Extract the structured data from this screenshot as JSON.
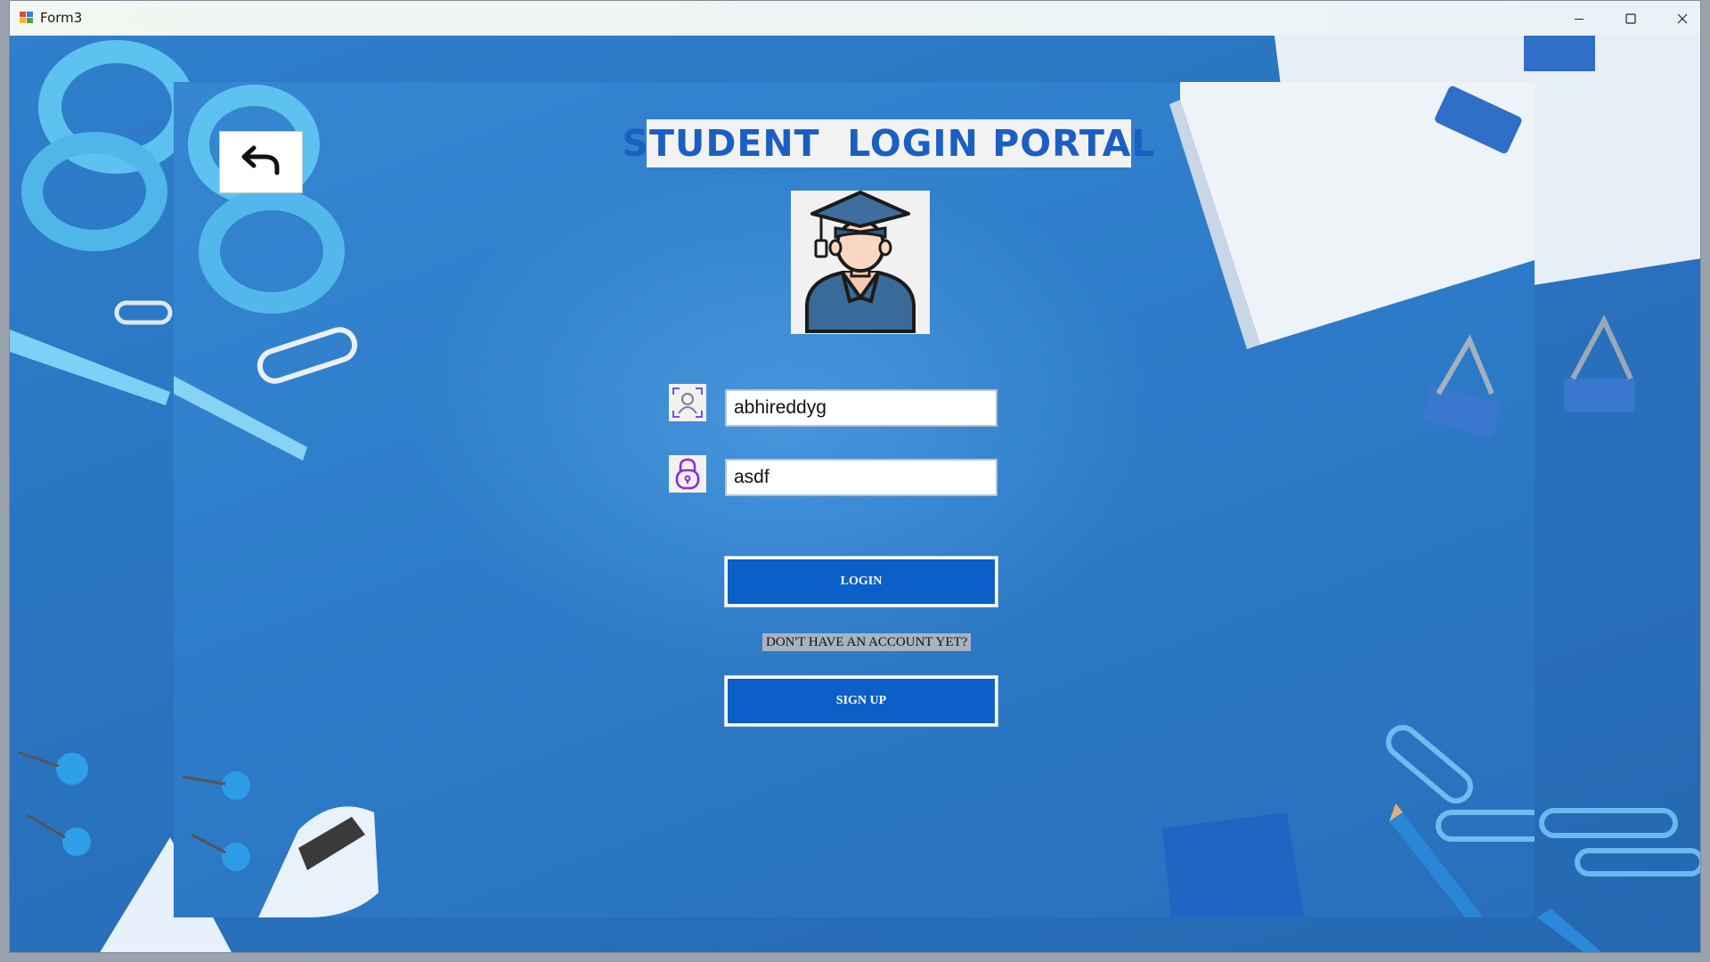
{
  "window": {
    "title": "Form3",
    "controls": {
      "minimize": "minimize-icon",
      "maximize": "maximize-icon",
      "close": "close-icon"
    }
  },
  "form": {
    "heading": "STUDENT  LOGIN PORTAL",
    "back_icon": "undo-arrow-icon",
    "avatar_icon": "graduate-student-icon",
    "username": {
      "icon": "user-icon",
      "value": "abhireddyg"
    },
    "password": {
      "icon": "lock-icon",
      "value": "asdf"
    },
    "login_label": "LOGIN",
    "account_prompt": "DON'T HAVE AN ACCOUNT YET?",
    "signup_label": "SIGN UP"
  },
  "colors": {
    "background": "#2f7fcc",
    "heading_text": "#1b5fc2",
    "button_fill": "#0b5fc9",
    "field_icon_accent": "#8a2be2"
  }
}
